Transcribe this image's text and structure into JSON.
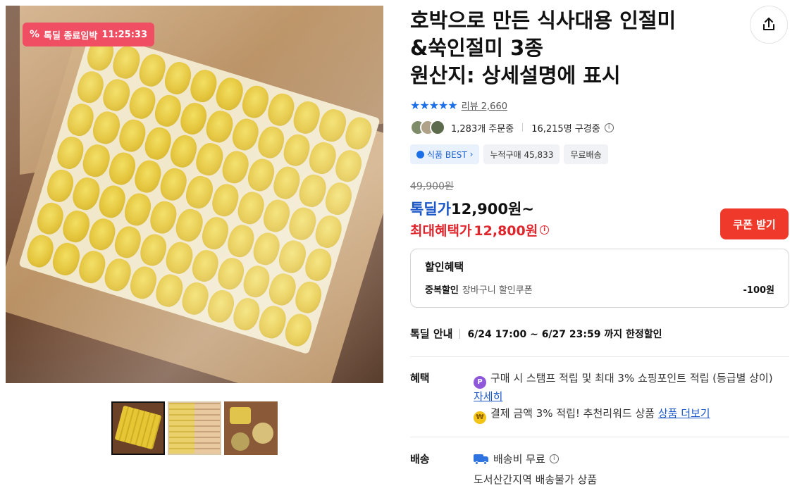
{
  "gallery": {
    "deal_badge_label": "톡딜 종료임박",
    "deal_badge_timer": "11:25:33",
    "thumbnails": [
      "thumb-1",
      "thumb-2",
      "thumb-3"
    ]
  },
  "product": {
    "title": "호박으로 만든 식사대용 인절미\n&쑥인절미 3종\n원산지: 상세설명에 표시",
    "rating_stars": "★★★★★",
    "review_label": "리뷰 2,660",
    "orders": "1,283개 주문중",
    "viewers": "16,215명 구경중",
    "tags": {
      "best": "식품 BEST",
      "cumulative": "누적구매 45,833",
      "free_shipping": "무료배송"
    }
  },
  "price": {
    "original": "49,900원",
    "deal_label": "톡딜가",
    "deal_value": "12,900원~",
    "max_benefit_label": "최대혜택가",
    "max_benefit_value": "12,800원",
    "coupon_button": "쿠폰 받기"
  },
  "discount": {
    "header": "할인혜택",
    "type": "중복할인",
    "desc": "장바구니 할인쿠폰",
    "amount": "-100원"
  },
  "deal_info": {
    "label": "톡딜 안내",
    "period": "6/24 17:00 ~ 6/27 23:59 까지 한정할인"
  },
  "benefits": {
    "label": "혜택",
    "line1": "구매 시 스탬프 적립 및 최대 3% 쇼핑포인트 적립 (등급별 상이)",
    "line1_link": "자세히",
    "line2": "결제 금액 3% 적립! 추천리워드 상품",
    "line2_link": "상품 더보기"
  },
  "shipping": {
    "label": "배송",
    "fee": "배송비 무료",
    "note": "도서산간지역 배송불가 상품"
  },
  "colors": {
    "deal_badge": "#f04e63",
    "deal_blue": "#1a56c8",
    "sale_red": "#e0262d",
    "coupon_button": "#ef3a2b",
    "stars": "#1a6ee8"
  }
}
